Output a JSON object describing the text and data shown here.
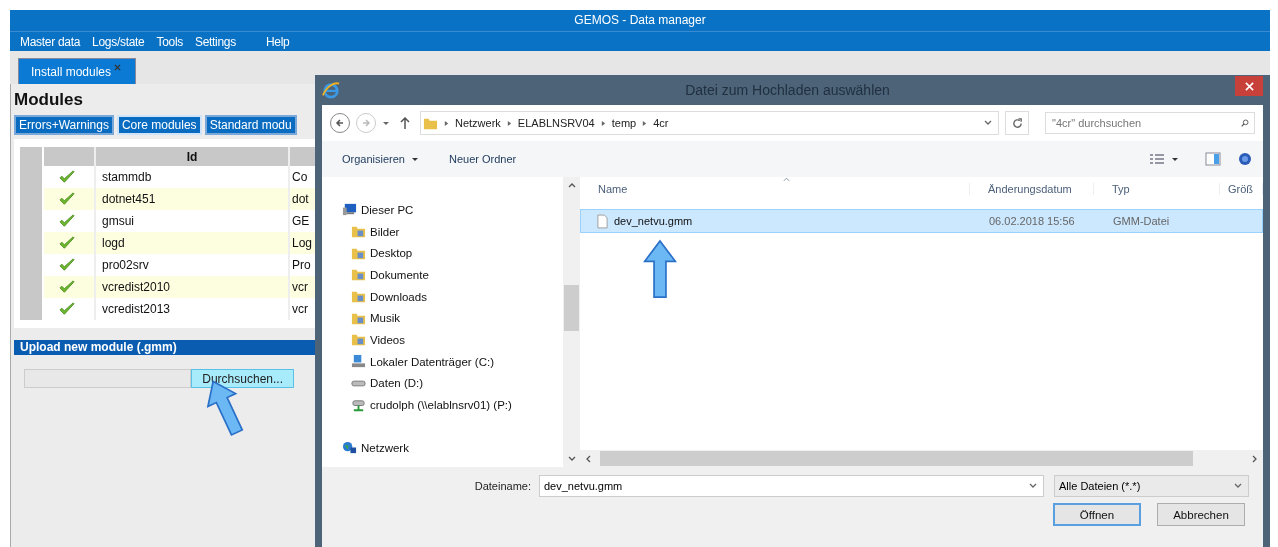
{
  "window": {
    "title": "GEMOS - Data manager"
  },
  "menu": [
    "Master data",
    "Logs/state",
    "Tools",
    "Settings",
    "Help"
  ],
  "tabs": [
    {
      "label": "Install modules",
      "selected": true
    }
  ],
  "modules": {
    "title": "Modules",
    "filters": [
      {
        "label": "Errors+Warnings",
        "selected": false
      },
      {
        "label": "Core modules",
        "selected": true
      },
      {
        "label": "Standard modu",
        "selected": false
      }
    ],
    "columns": [
      "Id"
    ],
    "rows": [
      {
        "id": "stammdb",
        "column_4": "Co"
      },
      {
        "id": "dotnet451",
        "column_4": "dot"
      },
      {
        "id": "gmsui",
        "column_4": "GE"
      },
      {
        "id": "logd",
        "column_4": "Log"
      },
      {
        "id": "pro02srv",
        "column_4": "Pro"
      },
      {
        "id": "vcredist2010",
        "column_4": "vcr"
      },
      {
        "id": "vcredist2013",
        "column_4": "vcr"
      }
    ]
  },
  "upload": {
    "title": "Upload new module (.gmm)",
    "button": "Durchsuchen..."
  },
  "dialog": {
    "title": "Datei zum Hochladen auswählen",
    "path": [
      "Netzwerk",
      "ELABLNSRV04",
      "temp",
      "4cr"
    ],
    "search": {
      "placeholder": "\"4cr\" durchsuchen"
    },
    "toolbar": [
      "Organisieren",
      "Neuer Ordner"
    ],
    "nav": [
      {
        "label": "Dieser PC",
        "kind": "pc",
        "children": [
          {
            "label": "Bilder",
            "kind": "folder"
          },
          {
            "label": "Desktop",
            "kind": "folder"
          },
          {
            "label": "Dokumente",
            "kind": "folder"
          },
          {
            "label": "Downloads",
            "kind": "folder"
          },
          {
            "label": "Musik",
            "kind": "folder"
          },
          {
            "label": "Videos",
            "kind": "folder"
          },
          {
            "label": "Lokaler Datenträger (C:)",
            "kind": "system-drive"
          },
          {
            "label": "Daten (D:)",
            "kind": "drive"
          },
          {
            "label": "crudolph (\\\\elablnsrv01) (P:)",
            "kind": "network-drive"
          }
        ]
      },
      {
        "label": "Netzwerk",
        "kind": "network"
      }
    ],
    "columns": [
      "Name",
      "Änderungsdatum",
      "Typ",
      "Größ"
    ],
    "files": [
      {
        "name": "dev_netvu.gmm",
        "date": "06.02.2018 15:56",
        "type": "GMM-Datei",
        "selected": true
      }
    ],
    "filename_label": "Dateiname:",
    "filename": "dev_netvu.gmm",
    "filter": "Alle Dateien (*.*)",
    "buttons": [
      "Öffnen",
      "Abbrechen"
    ]
  }
}
